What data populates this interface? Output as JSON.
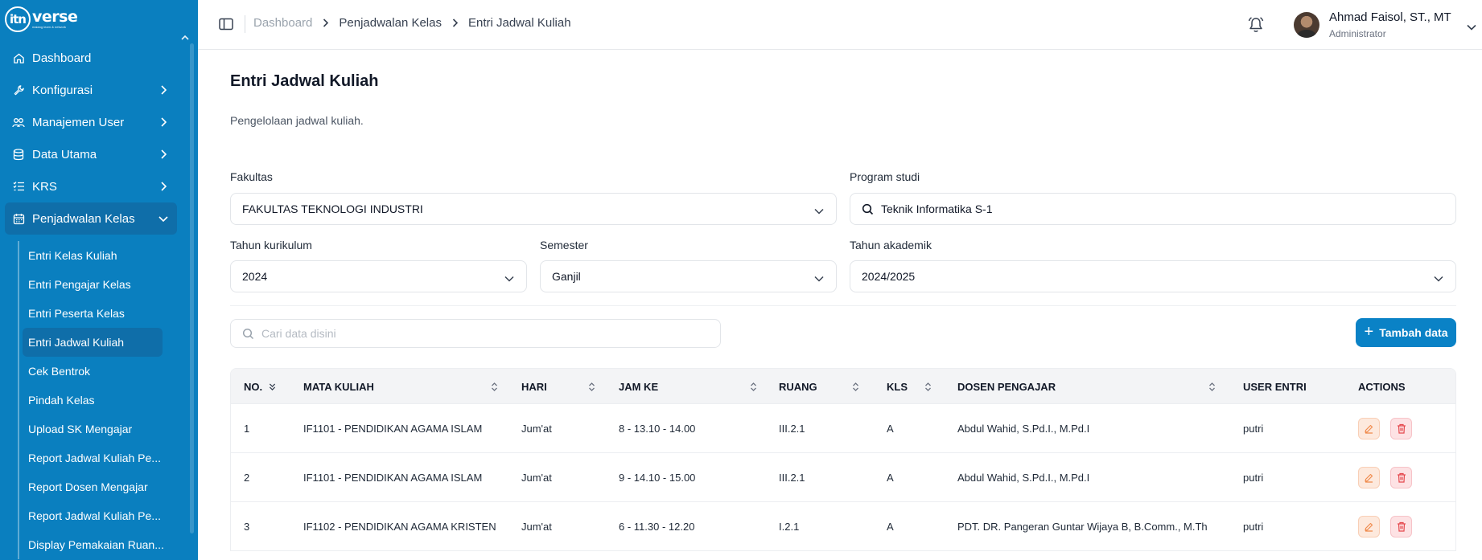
{
  "brand": {
    "logo_mark": "itn",
    "logo_word": "verse",
    "logo_tagline": "malang learn & network"
  },
  "sidebar": {
    "menu": [
      {
        "label": "Dashboard",
        "icon": "home-icon",
        "has_children": false
      },
      {
        "label": "Konfigurasi",
        "icon": "wrench-icon",
        "has_children": true
      },
      {
        "label": "Manajemen User",
        "icon": "users-icon",
        "has_children": true
      },
      {
        "label": "Data Utama",
        "icon": "database-icon",
        "has_children": true
      },
      {
        "label": "KRS",
        "icon": "list-icon",
        "has_children": true
      },
      {
        "label": "Penjadwalan Kelas",
        "icon": "calendar-icon",
        "has_children": true,
        "expanded": true
      }
    ],
    "submenu": [
      "Entri Kelas Kuliah",
      "Entri Pengajar Kelas",
      "Entri Peserta Kelas",
      "Entri Jadwal Kuliah",
      "Cek Bentrok",
      "Pindah Kelas",
      "Upload SK Mengajar",
      "Report Jadwal Kuliah Pe...",
      "Report Dosen Mengajar",
      "Report Jadwal Kuliah Pe...",
      "Display Pemakaian Ruan..."
    ],
    "active_submenu": "Entri Jadwal Kuliah"
  },
  "topbar": {
    "breadcrumb": [
      "Dashboard",
      "Penjadwalan Kelas",
      "Entri Jadwal Kuliah"
    ],
    "user": {
      "name": "Ahmad Faisol, ST., MT",
      "role": "Administrator"
    }
  },
  "page": {
    "title": "Entri Jadwal Kuliah",
    "subtitle": "Pengelolaan jadwal kuliah."
  },
  "filters": {
    "fakultas": {
      "label": "Fakultas",
      "value": "FAKULTAS TEKNOLOGI INDUSTRI"
    },
    "program_studi": {
      "label": "Program studi",
      "value": "Teknik Informatika S-1"
    },
    "tahun_kurikulum": {
      "label": "Tahun kurikulum",
      "value": "2024"
    },
    "semester": {
      "label": "Semester",
      "value": "Ganjil"
    },
    "tahun_akademik": {
      "label": "Tahun akademik",
      "value": "2024/2025"
    }
  },
  "search": {
    "placeholder": "Cari data disini",
    "value": ""
  },
  "add_button": {
    "label": "Tambah data"
  },
  "table": {
    "columns": [
      "NO.",
      "MATA KULIAH",
      "HARI",
      "JAM KE",
      "RUANG",
      "KLS",
      "DOSEN PENGAJAR",
      "USER ENTRI",
      "ACTIONS"
    ],
    "rows": [
      {
        "no": "1",
        "mata_kuliah": "IF1101 - PENDIDIKAN AGAMA ISLAM",
        "hari": "Jum'at",
        "jam_ke": "8 - 13.10 - 14.00",
        "ruang": "III.2.1",
        "kls": "A",
        "dosen": "Abdul Wahid, S.Pd.I., M.Pd.I",
        "user_entri": "putri"
      },
      {
        "no": "2",
        "mata_kuliah": "IF1101 - PENDIDIKAN AGAMA ISLAM",
        "hari": "Jum'at",
        "jam_ke": "9 - 14.10 - 15.00",
        "ruang": "III.2.1",
        "kls": "A",
        "dosen": "Abdul Wahid, S.Pd.I., M.Pd.I",
        "user_entri": "putri"
      },
      {
        "no": "3",
        "mata_kuliah": "IF1102 - PENDIDIKAN AGAMA KRISTEN",
        "hari": "Jum'at",
        "jam_ke": "6 - 11.30 - 12.20",
        "ruang": "I.2.1",
        "kls": "A",
        "dosen": "PDT. DR. Pangeran Guntar Wijaya B, B.Comm., M.Th",
        "user_entri": "putri"
      }
    ]
  },
  "colors": {
    "sidebar_bg": "#0a7fbf",
    "active_bg": "#0f6ea9",
    "primary_button": "#0a82c6",
    "edit_action": "#f08a4b",
    "delete_action": "#e5484d"
  }
}
